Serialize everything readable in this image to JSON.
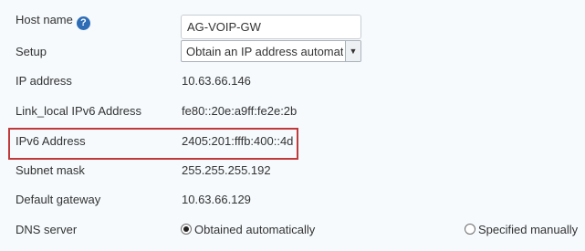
{
  "form": {
    "host_name": {
      "label": "Host name",
      "help_icon": "question-circle-icon",
      "value": "AG-VOIP-GW"
    },
    "setup": {
      "label": "Setup",
      "selected": "Obtain an IP address automatically"
    },
    "ip_address": {
      "label": "IP address",
      "value": "10.63.66.146"
    },
    "link_local_ipv6": {
      "label": "Link_local IPv6 Address",
      "value": "fe80::20e:a9ff:fe2e:2b"
    },
    "ipv6_address": {
      "label": "IPv6 Address",
      "value": "2405:201:fffb:400::4d"
    },
    "subnet_mask": {
      "label": "Subnet mask",
      "value": "255.255.255.192"
    },
    "default_gateway": {
      "label": "Default gateway",
      "value": "10.63.66.129"
    },
    "dns_server": {
      "label": "DNS server",
      "options": [
        {
          "label": "Obtained automatically",
          "checked": true
        },
        {
          "label": "Specified manually",
          "checked": false
        }
      ]
    }
  },
  "colors": {
    "highlight": "#c0393b",
    "help_icon": "#2e6db6",
    "background": "#f6fafd"
  }
}
